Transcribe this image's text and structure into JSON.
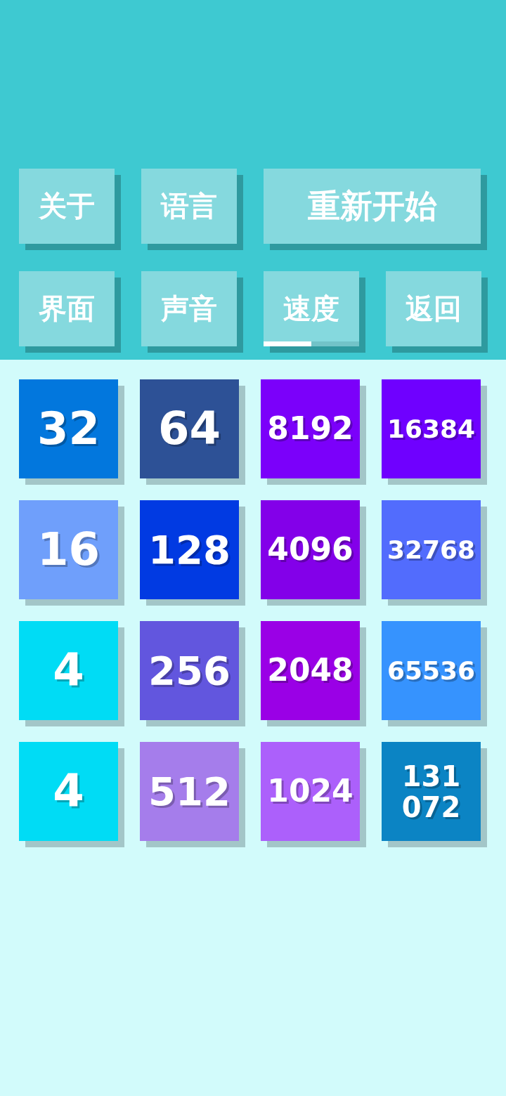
{
  "menu": {
    "rows": [
      [
        {
          "label": "关于",
          "kind": "small"
        },
        {
          "label": "语言",
          "kind": "small"
        },
        {
          "label": "重新开始",
          "kind": "wide"
        }
      ],
      [
        {
          "label": "界面",
          "kind": "small"
        },
        {
          "label": "声音",
          "kind": "small"
        },
        {
          "label": "速度",
          "kind": "slider",
          "level": 0.5
        },
        {
          "label": "返回",
          "kind": "small"
        }
      ]
    ]
  },
  "board": {
    "rows": [
      [
        {
          "value": "32",
          "color": "#0277dd"
        },
        {
          "value": "64",
          "color": "#2d5196"
        },
        {
          "value": "8192",
          "color": "#7b00fa"
        },
        {
          "value": "16384",
          "color": "#6f00ff"
        }
      ],
      [
        {
          "value": "16",
          "color": "#6f9ffb"
        },
        {
          "value": "128",
          "color": "#013ae2"
        },
        {
          "value": "4096",
          "color": "#8300e9"
        },
        {
          "value": "32768",
          "color": "#526cfd"
        }
      ],
      [
        {
          "value": "4",
          "color": "#00dcf5"
        },
        {
          "value": "256",
          "color": "#6256de"
        },
        {
          "value": "2048",
          "color": "#9a00e6"
        },
        {
          "value": "65536",
          "color": "#3693fe"
        }
      ],
      [
        {
          "value": "4",
          "color": "#00dcf5"
        },
        {
          "value": "512",
          "color": "#a57deb"
        },
        {
          "value": "1024",
          "color": "#ac60fb"
        },
        {
          "value": "131072",
          "color": "#0b84c4"
        }
      ]
    ]
  }
}
